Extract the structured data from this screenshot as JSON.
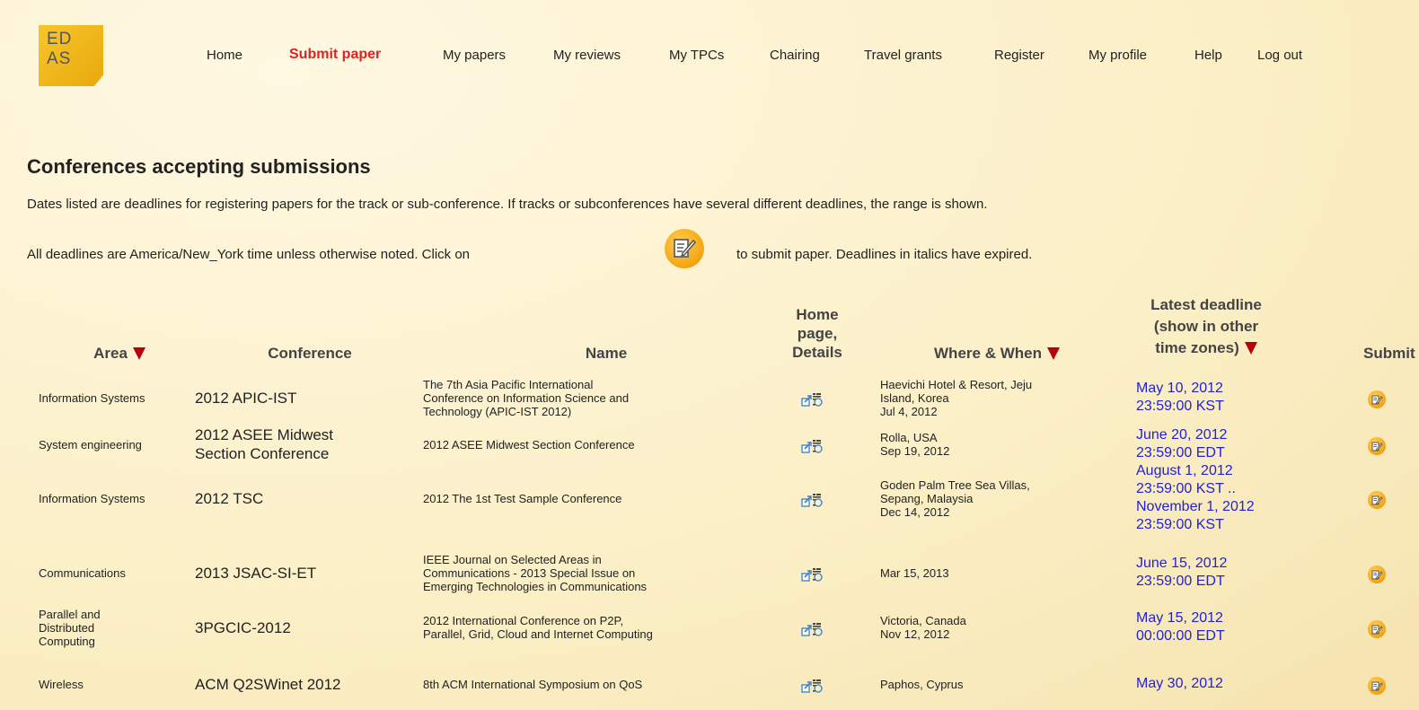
{
  "logo": {
    "line1": "ED",
    "line2": "AS"
  },
  "nav": [
    "Home",
    "Submit paper",
    "My papers",
    "My reviews",
    "My TPCs",
    "Chairing",
    "Travel grants",
    "Register",
    "My profile",
    "Help",
    "Log out"
  ],
  "page": {
    "title": "Conferences accepting submissions",
    "intro1": "Dates listed are deadlines for registering papers for the track or sub-conference. If tracks or subconferences have several different deadlines, the range is shown.",
    "intro2a": "All deadlines are America/New_York time unless otherwise noted. Click on",
    "intro2b": "to submit paper. Deadlines in italics have expired."
  },
  "columns": {
    "area": "Area",
    "conference": "Conference",
    "name": "Name",
    "home1": "Home",
    "home2": "page,",
    "home3": "Details",
    "where": "Where & When",
    "deadline1": "Latest deadline",
    "deadline2": "(show in other",
    "deadline3": "time zones)",
    "submit": "Submit"
  },
  "rows": [
    {
      "area": [
        "Information Systems"
      ],
      "conference": [
        "2012 APIC-IST"
      ],
      "name": [
        "The 7th Asia Pacific International",
        "Conference on Information Science and",
        "Technology (APIC-IST 2012)"
      ],
      "where": [
        "Haevichi Hotel & Resort, Jeju",
        "Island, Korea",
        "Jul 4, 2012"
      ],
      "deadline": [
        "May 10, 2012",
        "23:59:00 KST"
      ]
    },
    {
      "area": [
        "System engineering"
      ],
      "conference": [
        "2012 ASEE Midwest",
        "Section Conference"
      ],
      "name": [
        "2012 ASEE Midwest Section Conference"
      ],
      "where": [
        "Rolla, USA",
        "Sep 19, 2012"
      ],
      "deadline": [
        "June 20, 2012",
        "23:59:00 EDT"
      ]
    },
    {
      "area": [
        "Information Systems"
      ],
      "conference": [
        "2012 TSC"
      ],
      "name": [
        "2012 The 1st Test Sample Conference"
      ],
      "where": [
        "Goden Palm Tree Sea Villas,",
        "Sepang, Malaysia",
        "Dec 14, 2012"
      ],
      "deadline": [
        "August 1, 2012",
        "23:59:00 KST ..",
        "November 1, 2012",
        "23:59:00 KST"
      ]
    },
    {
      "area": [
        "Communications"
      ],
      "conference": [
        "2013 JSAC-SI-ET"
      ],
      "name": [
        "IEEE Journal on Selected Areas in",
        "Communications - 2013 Special Issue on",
        "Emerging Technologies in Communications"
      ],
      "where": [
        "Mar 15, 2013"
      ],
      "deadline": [
        "June 15, 2012",
        "23:59:00 EDT"
      ]
    },
    {
      "area": [
        "Parallel and",
        "Distributed",
        "Computing"
      ],
      "conference": [
        "3PGCIC-2012"
      ],
      "name": [
        "2012 International Conference on P2P,",
        "Parallel, Grid, Cloud and Internet Computing"
      ],
      "where": [
        "Victoria, Canada",
        "Nov 12, 2012"
      ],
      "deadline": [
        "May 15, 2012",
        "00:00:00 EDT"
      ]
    },
    {
      "area": [
        "Wireless"
      ],
      "conference": [
        "ACM Q2SWinet 2012"
      ],
      "name": [
        "8th ACM International Symposium on QoS"
      ],
      "where": [
        "Paphos, Cyprus"
      ],
      "deadline": [
        "May 30, 2012"
      ]
    }
  ]
}
